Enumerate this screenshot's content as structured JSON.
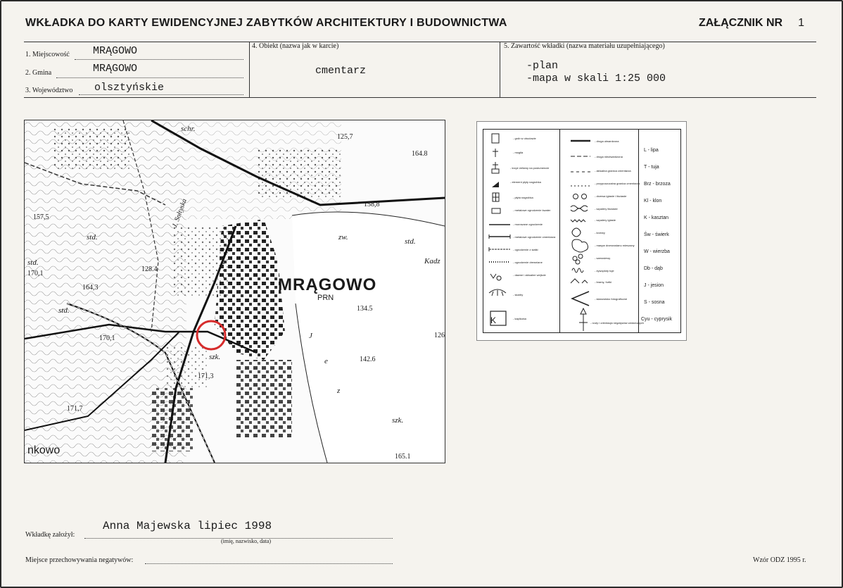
{
  "header": {
    "title": "WKŁADKA DO KARTY EWIDENCYJNEJ ZABYTKÓW ARCHITEKTURY I BUDOWNICTWA",
    "annex_label": "ZAŁĄCZNIK NR",
    "annex_number": "1"
  },
  "fields": {
    "locality_label": "1. Miejscowość",
    "locality_value": "MRĄGOWO",
    "commune_label": "2. Gmina",
    "commune_value": "MRĄGOWO",
    "voivodeship_label": "3. Województwo",
    "voivodeship_value": "olsztyńskie",
    "object_label": "4. Obiekt  (nazwa jak w karcie)",
    "object_value": "cmentarz",
    "contents_label": "5. Zawartość wkładki  (nazwa materiału uzupełniającego)",
    "contents_line1": "-plan",
    "contents_line2": "-mapa w skali 1:25 000"
  },
  "map": {
    "town_name": "MRĄGOWO",
    "town_code": "PRN",
    "labels": [
      "schr.",
      "125,7",
      "164.8",
      "158,8",
      "157,5",
      "std.",
      "std.",
      "170,1",
      "164,3",
      "128.4",
      "std.",
      "170,1",
      "171,3",
      "171,7",
      "szk.",
      "zw.",
      "std.",
      "Kadz",
      "134.5",
      "126",
      "142.6",
      "szk.",
      "165.1",
      "nkowo",
      "J. Sołtyska",
      "J",
      "e",
      "z"
    ]
  },
  "legend": {
    "left_items": [
      "- grób w obudowie",
      "- mogiła",
      "- krzyż żeliwny na postumencie",
      "- element płyty nagrobka",
      "- płyta nagrobka",
      "- metalowe ogrodzenie kwater",
      "- murowane ogrodzenie",
      "- metalowe ogrodzenie cmentarza",
      "- ogrodzenie z siatki",
      "- ogrodzenie drewniane",
      "- dawne i aktualne wejście",
      "- skarby",
      "- kapliczka"
    ],
    "middle_items": [
      "- droga utwardzona",
      "- droga nieutwardzona",
      "- aktualna granica cmentarza",
      "- przypuszczalna granica cmentarza",
      "- drzewa iglaste i liściaste",
      "- szpalery liściaste",
      "- szpalery iglaste",
      "- krzewy",
      "- masyw drzewostanu mieszany",
      "- samosiewy",
      "- żywopłoty tuje",
      "- bramy, furtki",
      "- stanowisko fotograficzne",
      "- rzuty i orientacja negatywów wedutowych"
    ],
    "trees": [
      "L - lipa",
      "T - tuja",
      "Brz - brzoza",
      "Kl - klon",
      "K - kasztan",
      "Św - świerk",
      "W - wierzba",
      "Db - dąb",
      "J - jesion",
      "S - sosna",
      "Cyu - cyprysik"
    ],
    "k_symbol": "K"
  },
  "footer": {
    "founder_label": "Wkładkę założył:",
    "founder_value": "Anna Majewska  lipiec 1998",
    "founder_hint": "(imię, nazwisko, data)",
    "negatives_label": "Miejsce przechowywania negatywów:",
    "form_model": "Wzór ODZ 1995 r."
  },
  "colors": {
    "marker": "#d62b2b",
    "ink": "#1a1a1a",
    "paper": "#f5f3ee"
  }
}
